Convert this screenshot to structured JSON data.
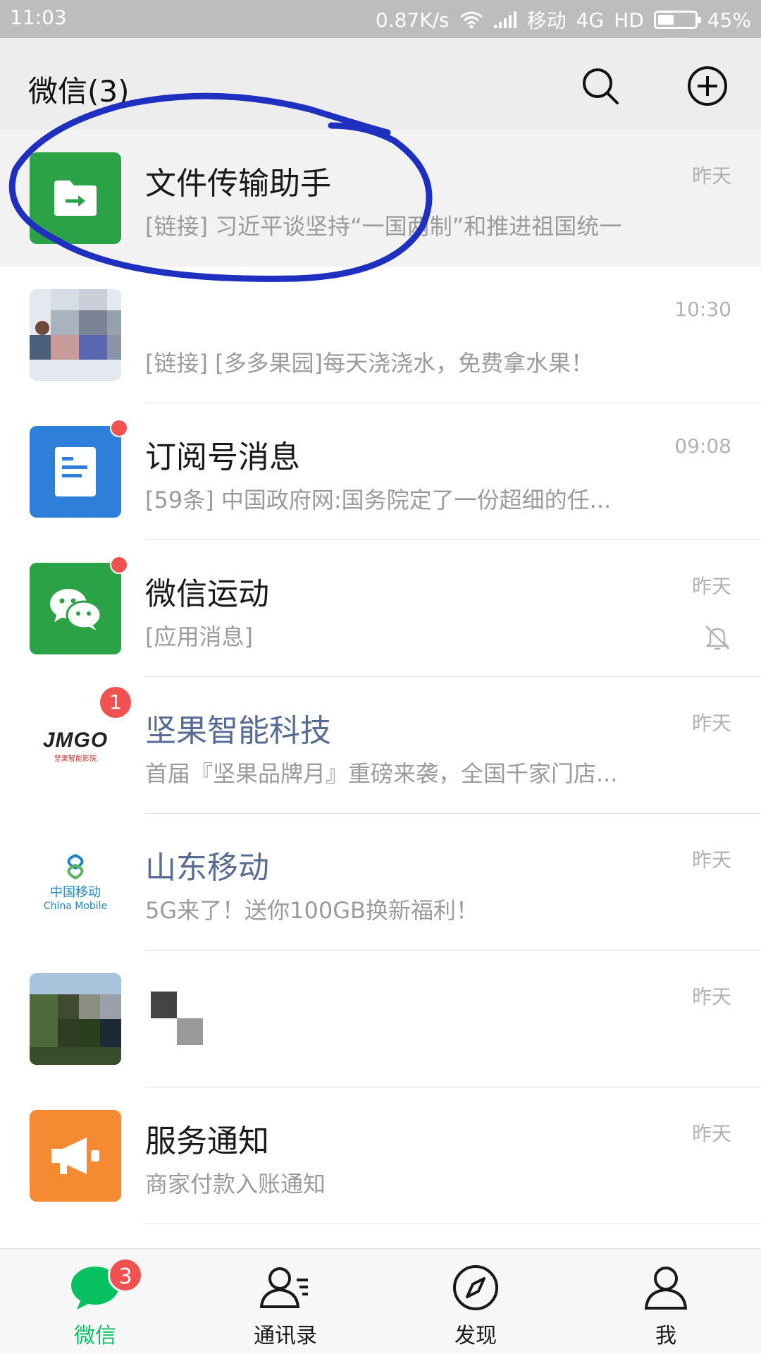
{
  "status_bar": {
    "time": "11:03",
    "net_speed": "0.87K/s",
    "carrier": "移动",
    "network": "4G",
    "hd": "HD",
    "battery_text": "45%",
    "battery_level": 0.45
  },
  "header": {
    "title": "微信(3)",
    "search_icon": "search-icon",
    "add_icon": "plus-circle-icon"
  },
  "chats": [
    {
      "name": "文件传输助手",
      "preview": "[链接] 习近平谈坚持“一国两制”和推进祖国统一",
      "time": "昨天"
    },
    {
      "name": "",
      "preview": "[链接] [多多果园]每天浇浇水，免费拿水果！",
      "time": "10:30"
    },
    {
      "name": "订阅号消息",
      "preview": "[59条] 中国政府网:国务院定了一份超细的任...",
      "time": "09:08"
    },
    {
      "name": "微信运动",
      "preview": "[应用消息]",
      "time": "昨天"
    },
    {
      "name": "坚果智能科技",
      "preview": "首届『坚果品牌月』重磅来袭，全国千家门店...",
      "time": "昨天",
      "badge": "1",
      "avatar_text": "JMGO",
      "avatar_sub": "坚果智能影院"
    },
    {
      "name": "山东移动",
      "preview": "5G来了！送你100GB换新福利！",
      "time": "昨天",
      "avatar_text": "中国移动",
      "avatar_sub": "China Mobile"
    },
    {
      "name": "",
      "preview": "",
      "time": "昨天"
    },
    {
      "name": "服务通知",
      "preview": "商家付款入账通知",
      "time": "昨天"
    }
  ],
  "tabs": [
    {
      "label": "微信",
      "badge": "3"
    },
    {
      "label": "通讯录"
    },
    {
      "label": "发现"
    },
    {
      "label": "我"
    }
  ],
  "colors": {
    "wechat_green": "#07c160",
    "file_helper_green": "#2ba245",
    "subscription_blue": "#2d7fd9",
    "service_orange": "#f58a33",
    "badge_red": "#f25151",
    "annotation_blue": "#1f2fbf"
  }
}
